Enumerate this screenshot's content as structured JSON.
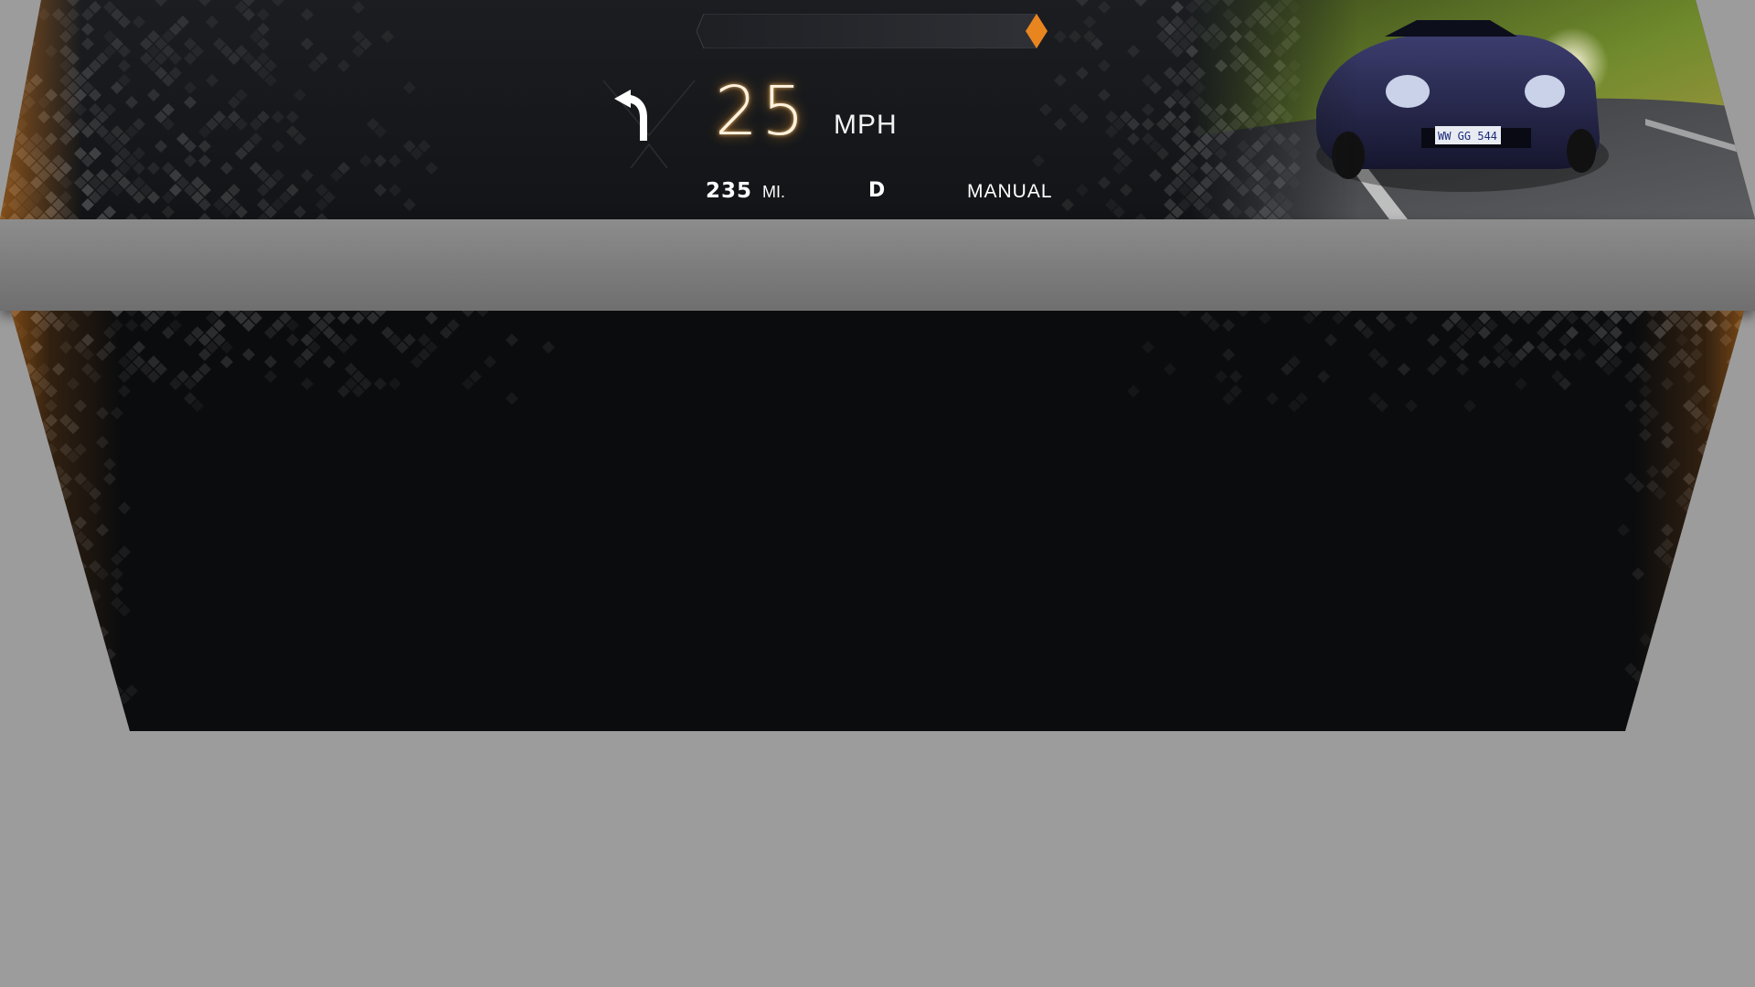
{
  "cluster": {
    "speed_value": "25",
    "speed_unit": "MPH",
    "range_value": "235",
    "range_unit": "MI.",
    "gear": "D",
    "drive_mode": "MANUAL",
    "progress_fraction": 1.0,
    "navigation_icon": "turn-left-arrow-icon",
    "license_plate": "WW GG 544"
  },
  "colors": {
    "accent": "#e8851f",
    "background": "#9c9c9c",
    "panel": "#121417"
  }
}
